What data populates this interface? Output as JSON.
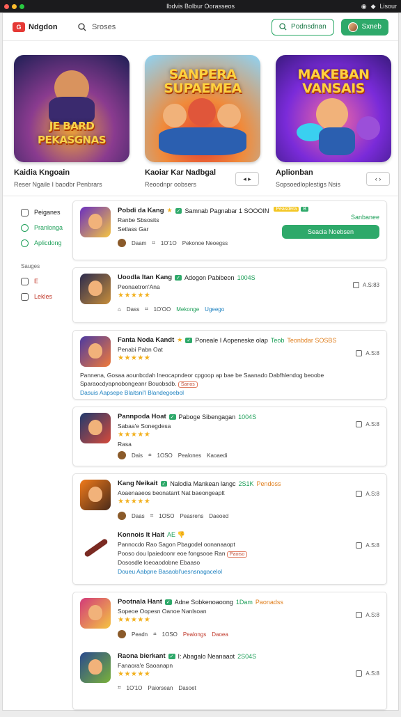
{
  "os": {
    "title": "Ibdvis Bolbur Oorasseos",
    "right": "Lisour"
  },
  "header": {
    "logo": "Ndgdon",
    "search_placeholder": "Sroses",
    "outline_btn": "Podnsdnan",
    "green_btn": "Sxneb"
  },
  "featured": [
    {
      "art_title": "SANPERA SUPAEMEA",
      "name": "Kaidia Kngoain",
      "sub": "Reser Ngaile I baodbr Penbrars",
      "bg1": "#2a2a6e",
      "bg2": "#f0a53a",
      "title_art": "JE BARD PEKASGNAS"
    },
    {
      "art_title": "SANPERA SUPAEMEA",
      "name": "Kaoiar Kar Nadbgal",
      "sub": "Reoodnpr oobsers",
      "bg1": "#8ed3f5",
      "bg2": "#e23b2e"
    },
    {
      "art_title": "MAKEBAN VANSAIS",
      "name": "Aplionban",
      "sub": "Sopsoedloplestigs Nsis",
      "bg1": "#7a2bd9",
      "bg2": "#f46aa2"
    }
  ],
  "sidebar": {
    "items": [
      {
        "label": "Peiganes",
        "color": "#222"
      },
      {
        "label": "Pranlonga",
        "color": "#1e9f59"
      },
      {
        "label": "Aplicdong",
        "color": "#1e9f59"
      }
    ],
    "section": "Sauges",
    "sub_items": [
      {
        "label": "E",
        "color": "#c0392b"
      },
      {
        "label": "Lekles",
        "color": "#c0392b"
      }
    ]
  },
  "apps": [
    {
      "title": "Pobdi da Kang",
      "star_icon": "★",
      "extra": "Samnab Pagnabar 1 SOOOIN",
      "dev": "Ranbe Sbsosits",
      "dev2": "Setlass Gar",
      "meta1": "Daam",
      "meta2": "1O'1O",
      "meta3": "Pekonoe Neoegss",
      "chip_y": "Peasdera",
      "chip_g": "B",
      "green_right": "Sanbanee",
      "install": "Seacia Noebsen",
      "icon_c1": "#6a2fbf",
      "icon_c2": "#f5c542"
    },
    {
      "title": "Uoodla Itan Kang",
      "extra": "Adogon Pabibeon",
      "extra_g": "1004S",
      "dev": "Peonaetron'Ana",
      "stars": "★★★★★",
      "meta1": "Dass",
      "meta2": "1O'OO",
      "meta3": "Mekonge",
      "meta4": "Ugeego",
      "rating": "A.S:83",
      "icon_c1": "#2b2b4e",
      "icon_c2": "#c78d3a"
    },
    {
      "title": "Fanta Noda Kandt",
      "star_icon": "★",
      "extra": "Poneale I Aopeneske olap",
      "extra_g": "Teob",
      "extra_o": "Teonbdar SOSBS",
      "dev": "Penabi Pabn Oat",
      "stars": "★★★★★",
      "desc": "Pannena, Gosaa aounbcdah lneocapndeor cpgoop ap bae be Saanado Dabfhlendog beoobe Sparaocdyapnobongeanr Bouobsdb.",
      "tag": "Sanos",
      "link": "Dasuis Aapsepe Blaitsni'l Blandegoebol",
      "rating": "A.S:8",
      "icon_c1": "#4c3aa1",
      "icon_c2": "#f07a3a"
    },
    {
      "title": "Pannpoda Hoat",
      "extra": "Paboge Sibengagan",
      "extra_g": "1004S",
      "dev": "Sabaa'e Sonegdesa",
      "stars": "★★★★★",
      "dev2": "Rasa",
      "meta1": "Dais",
      "meta2": "1OSO",
      "meta3": "Pealones",
      "meta4": "Kaoaedi",
      "rating": "A.S:8",
      "icon_c1": "#1f3a6e",
      "icon_c2": "#d64a3a"
    },
    {
      "title": "Kang Neikait",
      "extra": "Nalodia Mankean langc",
      "extra_g": "2S1K",
      "extra_o": "Pendoss",
      "dev": "Aoaenaaeos beonatarrt Nat baeongeaplt",
      "stars": "★★★★★",
      "meta1": "Daas",
      "meta2": "1OSO",
      "meta3": "Peasrens",
      "meta4": "Daeoed",
      "rating": "A.S:8",
      "icon_c1": "#f07a1a",
      "icon_c2": "#4b2b1a"
    },
    {
      "title": "Konnois It Hait",
      "extra": "AE 👎",
      "dev": "Pannocdo Rao Sagon Pbagodel oonanaaopt",
      "dev2": "Pooso dou lpaiedoonr eoe fongsooe Ran",
      "dev3": "Dososdle loeoaodobne Ebaaso",
      "tag": "Paoiso",
      "link": "Doueu Aabpne Basaobl'uesnsnagacelol",
      "rating": "A.S:8",
      "icon_c1": "#ffffff",
      "icon_c2": "#a0302a"
    },
    {
      "title": "Pootnala Hant",
      "extra": "Adne Sobkenoaoong",
      "extra_g": "1Dam",
      "extra_o": "Paonadss",
      "dev": "Sopeoe Oopesn Oanoe Nanlsoan",
      "stars": "★★★★★",
      "meta1": "Peadn",
      "meta2": "1OSO",
      "meta3": "Pealongs",
      "meta4": "Daoea",
      "rating": "A.S:8",
      "icon_c1": "#d23a7a",
      "icon_c2": "#f5c542"
    },
    {
      "title": "Raona bierkant",
      "extra": "I: Abagalo Neanaaot",
      "extra_g": "2S04S",
      "dev": "Fanaora'e Saoanapn",
      "stars": "★★★★★",
      "meta2": "1O'1O",
      "meta3": "Paiorsean",
      "meta4": "Dasoet",
      "rating": "A.S:8",
      "icon_c1": "#2a4a8e",
      "icon_c2": "#7ab13a"
    }
  ]
}
